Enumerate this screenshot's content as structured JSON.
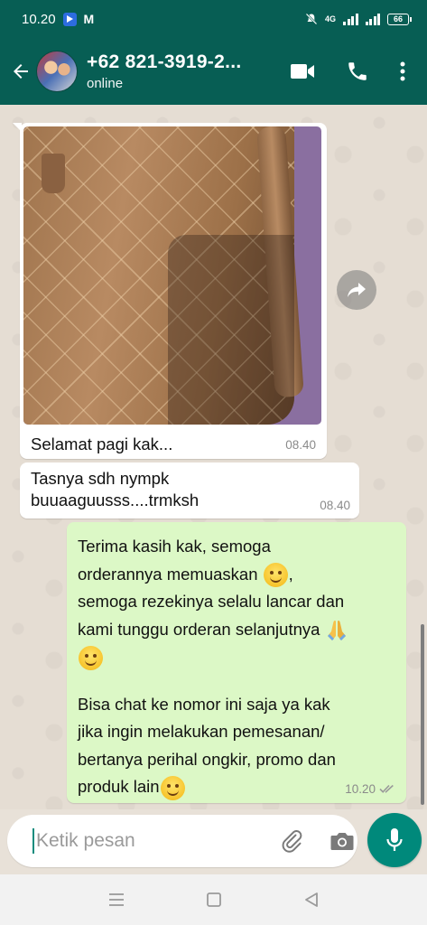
{
  "status_bar": {
    "time": "10.20",
    "network": "4G",
    "battery": "66"
  },
  "header": {
    "contact_name": "+62 821-3919-2...",
    "contact_status": "online"
  },
  "messages": [
    {
      "direction": "incoming",
      "type": "image",
      "caption": "Selamat pagi kak...",
      "time": "08.40"
    },
    {
      "direction": "incoming",
      "type": "text",
      "text_line1": "Tasnya sdh nympk",
      "text_line2": "buuaaguusss....trmksh",
      "time": "08.40"
    },
    {
      "direction": "outgoing",
      "type": "text",
      "line1": "Terima kasih kak, semoga",
      "line2": "orderannya memuaskan",
      "line2_suffix": ",",
      "line3": "semoga rezekinya selalu lancar dan",
      "line4": "kami tunggu orderan selanjutnya",
      "line6": "Bisa chat ke nomor ini saja ya kak",
      "line7": "jika ingin melakukan pemesanan/",
      "line8": "bertanya perihal ongkir, promo dan",
      "line9": "produk lain",
      "time": "10.20",
      "status": "read"
    }
  ],
  "composer": {
    "placeholder": "Ketik pesan"
  },
  "colors": {
    "header": "#075e54",
    "outgoing_bubble": "#dcf8c6",
    "incoming_bubble": "#ffffff",
    "mic_button": "#00897b",
    "chat_background": "#e5ddd3"
  },
  "icons": [
    "back-arrow-icon",
    "video-call-icon",
    "phone-icon",
    "more-vert-icon",
    "forward-icon",
    "emoji-icon",
    "attach-icon",
    "camera-icon",
    "mic-icon",
    "recents-nav-icon",
    "home-nav-icon",
    "back-nav-icon"
  ]
}
